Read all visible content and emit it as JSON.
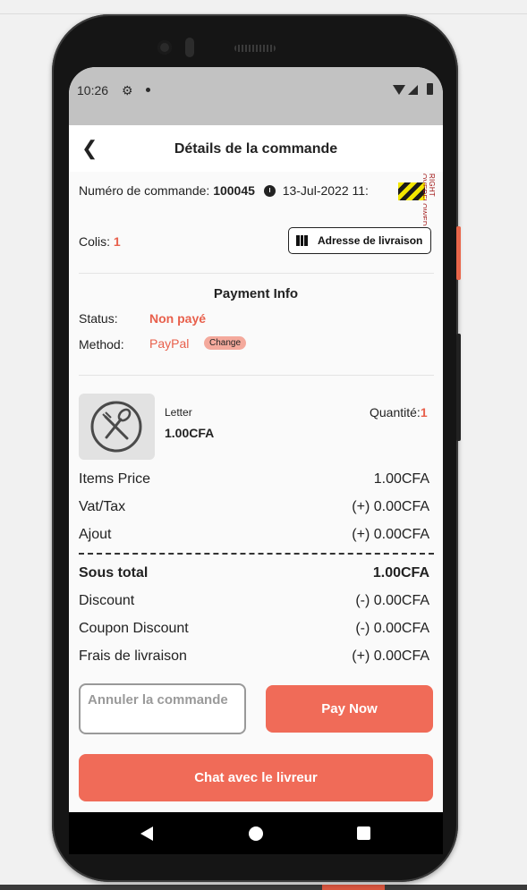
{
  "status_bar": {
    "time": "10:26"
  },
  "app_bar": {
    "title": "Détails de la commande"
  },
  "order": {
    "number_label": "Numéro de commande:",
    "number": "100045",
    "date": "13-Jul-2022 11:",
    "overflow_text": "RIGHT OVERFLOWED BY"
  },
  "colis": {
    "label": "Colis:",
    "count": "1"
  },
  "address_button": {
    "label": "Adresse de livraison"
  },
  "payment": {
    "title": "Payment Info",
    "status_label": "Status:",
    "status_value": "Non payé",
    "method_label": "Method:",
    "method_value": "PayPal",
    "change_label": "Change"
  },
  "product": {
    "name": "Letter",
    "price": "1.00CFA",
    "quantity_label": "Quantité:",
    "quantity": "1"
  },
  "summary": {
    "items_price_label": "Items Price",
    "items_price": "1.00CFA",
    "vat_label": "Vat/Tax",
    "vat": "(+) 0.00CFA",
    "ajout_label": "Ajout",
    "ajout": "(+) 0.00CFA",
    "subtotal_label": "Sous total",
    "subtotal": "1.00CFA",
    "discount_label": "Discount",
    "discount": "(-) 0.00CFA",
    "coupon_label": "Coupon Discount",
    "coupon": "(-) 0.00CFA",
    "delivery_label": "Frais de livraison",
    "delivery": "(+) 0.00CFA"
  },
  "actions": {
    "cancel_label": "Annuler la commande",
    "pay_label": "Pay Now",
    "chat_label": "Chat avec le livreur"
  },
  "colors": {
    "accent": "#f06b58",
    "red_text": "#e8604c"
  }
}
